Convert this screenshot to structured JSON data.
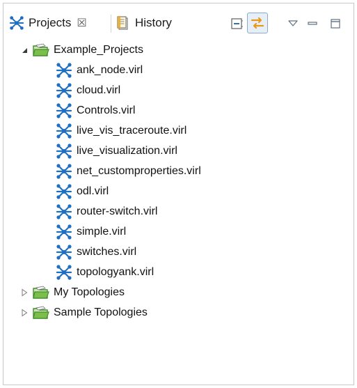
{
  "tabs": [
    {
      "label": "Projects",
      "icon": "topology-icon",
      "active": true,
      "close_glyph": "☒"
    },
    {
      "label": "History",
      "icon": "history-icon",
      "active": false
    }
  ],
  "toolbar": {
    "collapse_all": "collapse-all-icon",
    "link_with_editor": "link-with-editor-icon",
    "view_menu": "view-menu-icon",
    "minimize": "minimize-icon",
    "maximize": "maximize-icon"
  },
  "colors": {
    "topology_blue": "#1e6fc4",
    "folder_green": "#3f8f2a",
    "link_orange": "#e89a17"
  },
  "tree": {
    "projects": [
      {
        "label": "Example_Projects",
        "expanded": true,
        "files": [
          "ank_node.virl",
          "cloud.virl",
          "Controls.virl",
          "live_vis_traceroute.virl",
          "live_visualization.virl",
          "net_customproperties.virl",
          "odl.virl",
          "router-switch.virl",
          "simple.virl",
          "switches.virl",
          "topologyank.virl"
        ]
      },
      {
        "label": "My Topologies",
        "expanded": false,
        "files": []
      },
      {
        "label": "Sample Topologies",
        "expanded": false,
        "files": []
      }
    ]
  }
}
